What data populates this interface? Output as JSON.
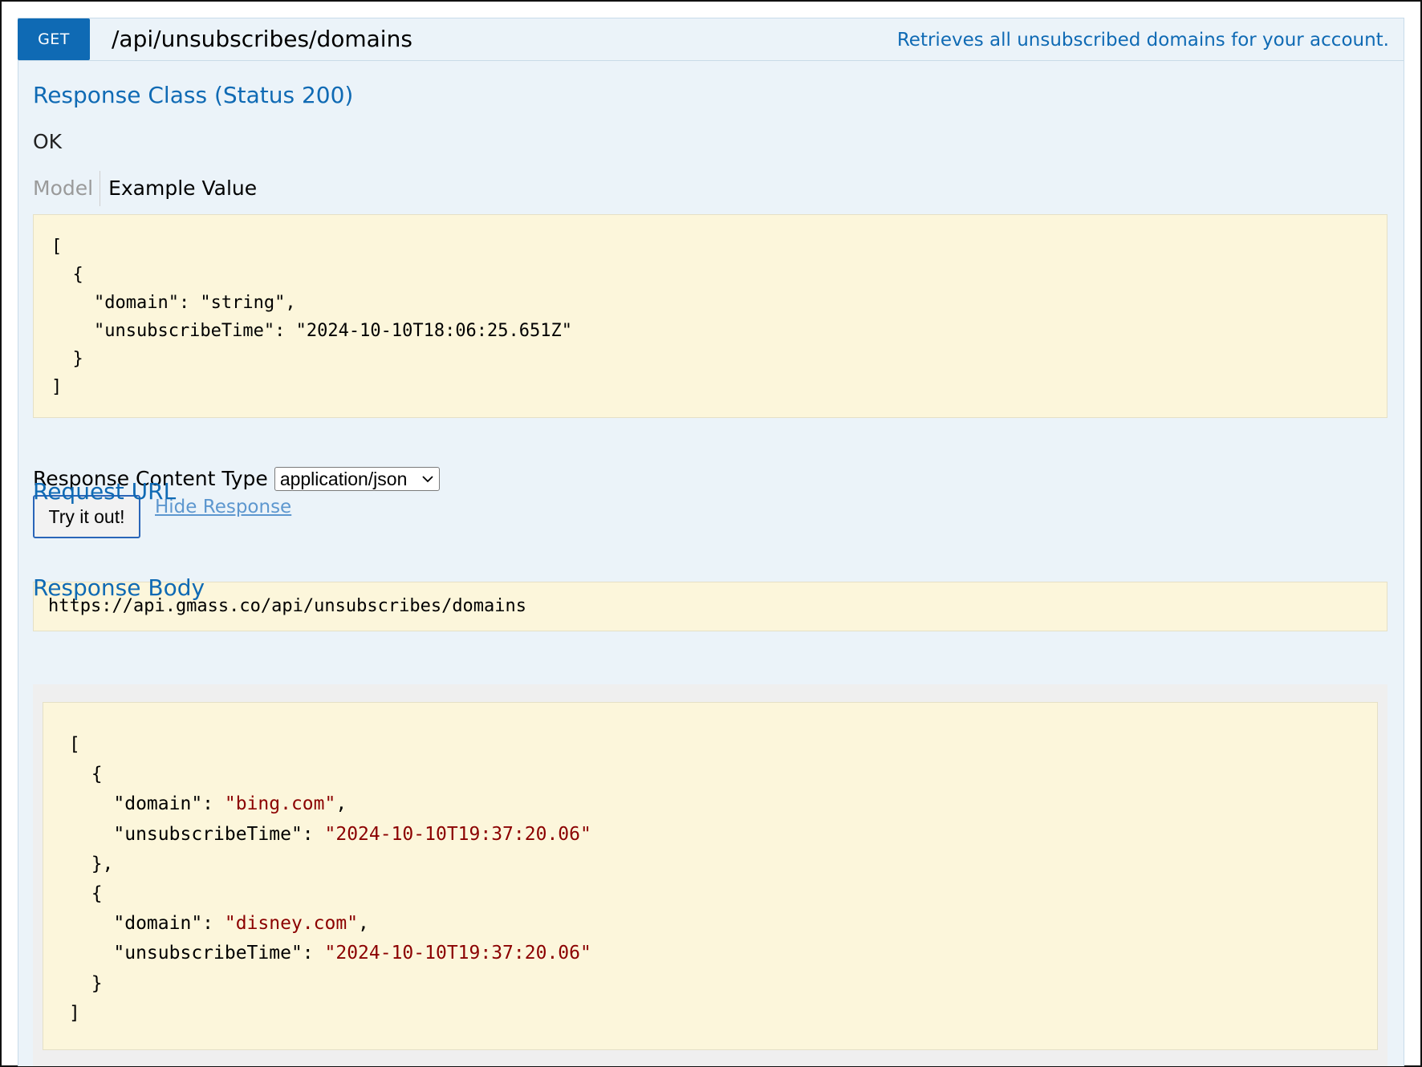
{
  "operation": {
    "method": "GET",
    "path": "/api/unsubscribes/domains",
    "summary": "Retrieves all unsubscribed domains for your account."
  },
  "response_class": {
    "heading": "Response Class (Status 200)",
    "status_text": "OK",
    "tabs": {
      "model": "Model",
      "example": "Example Value"
    },
    "example_lines": [
      "[",
      "  {",
      "    \"domain\": \"string\",",
      "    \"unsubscribeTime\": \"2024-10-10T18:06:25.651Z\"",
      "  }",
      "]"
    ]
  },
  "content_type": {
    "label": "Response Content Type",
    "selected": "application/json"
  },
  "actions": {
    "try_label": "Try it out!",
    "hide_label": "Hide Response"
  },
  "request_url": {
    "heading": "Request URL",
    "value": "https://api.gmass.co/api/unsubscribes/domains"
  },
  "response_body": {
    "heading": "Response Body",
    "items": [
      {
        "domain": "\"bing.com\"",
        "unsubscribeTime": "\"2024-10-10T19:37:20.06\""
      },
      {
        "domain": "\"disney.com\"",
        "unsubscribeTime": "\"2024-10-10T19:37:20.06\""
      }
    ],
    "key_domain": "\"domain\"",
    "key_time": "\"unsubscribeTime\""
  },
  "colors": {
    "method_badge": "#0f6ab4",
    "heading": "#0f6ab4",
    "code_bg": "#fcf6db",
    "string_value": "#8b0000",
    "panel_bg": "#ebf3f9"
  }
}
